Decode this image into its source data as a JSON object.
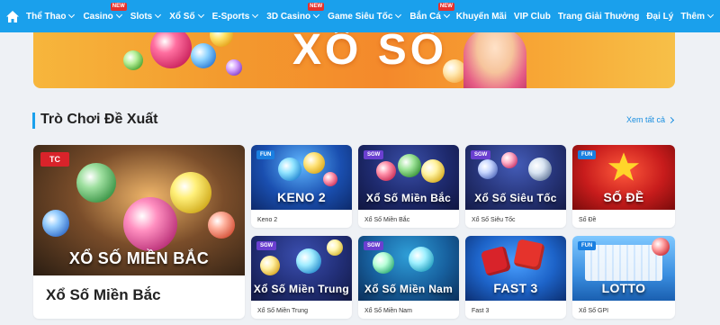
{
  "nav": {
    "items": [
      {
        "label": "Thể Thao",
        "badge": ""
      },
      {
        "label": "Casino",
        "badge": "NEW"
      },
      {
        "label": "Slots",
        "badge": ""
      },
      {
        "label": "Xổ Số",
        "badge": ""
      },
      {
        "label": "E-Sports",
        "badge": ""
      },
      {
        "label": "3D Casino",
        "badge": "NEW"
      },
      {
        "label": "Game Siêu Tốc",
        "badge": ""
      },
      {
        "label": "Bắn Cá",
        "badge": "NEW"
      }
    ],
    "right": [
      "Khuyến Mãi",
      "VIP Club",
      "Trang Giải Thưởng",
      "Đại Lý",
      "Thêm"
    ]
  },
  "banner": {
    "title": "XỔ SỐ"
  },
  "section": {
    "title": "Trò Chơi Đề Xuất",
    "see_all": "Xem tất cả"
  },
  "featured": {
    "tag": "TC",
    "thumb_label": "XỔ SỐ MIỀN BẮC",
    "name": "Xổ Số Miền Bắc"
  },
  "games": [
    {
      "tag": "FUN",
      "thumb_label": "KENO 2",
      "name": "Keno 2"
    },
    {
      "tag": "SGW",
      "thumb_label": "Xổ Số Miền Bắc",
      "name": "Xổ Số Miền Bắc"
    },
    {
      "tag": "SGW",
      "thumb_label": "Xổ Số Siêu Tốc",
      "name": "Xổ Số Siêu Tốc"
    },
    {
      "tag": "FUN",
      "thumb_label": "SỐ ĐỀ",
      "name": "Số Đề"
    },
    {
      "tag": "SGW",
      "thumb_label": "Xổ Số Miền Trung",
      "name": "Xổ Số Miền Trung"
    },
    {
      "tag": "SGW",
      "thumb_label": "Xổ Số Miền Nam",
      "name": "Xổ Số Miền Nam"
    },
    {
      "tag": "",
      "thumb_label": "FAST 3",
      "name": "Fast 3"
    },
    {
      "tag": "FUN",
      "thumb_label": "LOTTO",
      "name": "Xổ Số GPI"
    }
  ],
  "colors": {
    "nav_bg": "#1aa0ec",
    "accent": "#1aa0ec",
    "badge": "#e5322d",
    "tc_tag": "#d9232a"
  },
  "icons": {
    "home": "home-icon",
    "chevron": "chevron-down-icon",
    "see_all": "chevron-right-icon"
  }
}
